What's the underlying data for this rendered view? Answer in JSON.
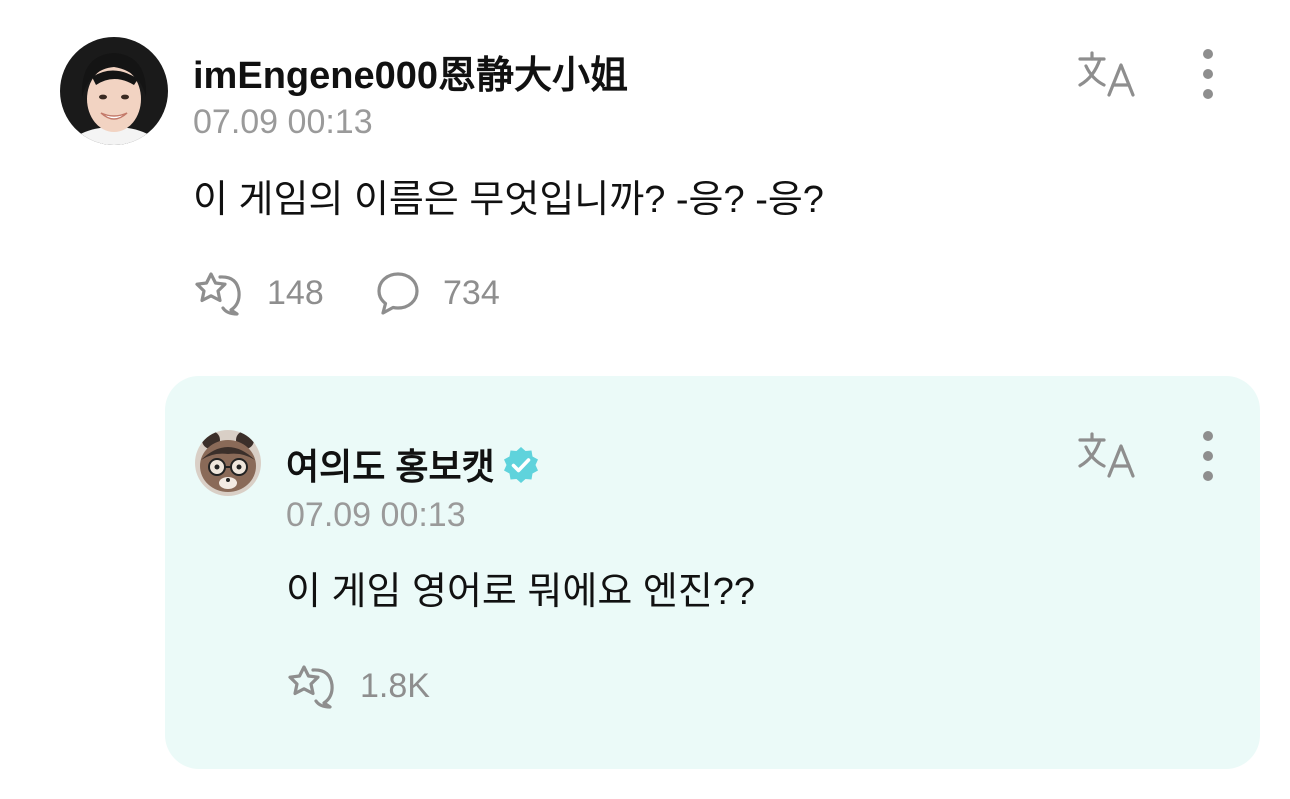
{
  "post": {
    "author": "imEngene000恩静大小姐",
    "timestamp": "07.09 00:13",
    "text": "이 게임의 이름은 무엇입니까? -응? -응?",
    "likes": "148",
    "comments": "734"
  },
  "reply": {
    "author": "여의도 홍보캣",
    "verified": true,
    "timestamp": "07.09 00:13",
    "text": "이 게임 영어로 뭐에요 엔진??",
    "likes": "1.8K"
  },
  "colors": {
    "reply_background": "#ebfaf8",
    "verified_badge": "#5fd3dc",
    "meta_gray": "#9a9a9a",
    "icon_gray": "#8e8e8e"
  },
  "icons": {
    "translate": "translate-icon",
    "more": "more-vertical-icon",
    "like": "star-heart-icon",
    "comment": "speech-bubble-icon"
  }
}
